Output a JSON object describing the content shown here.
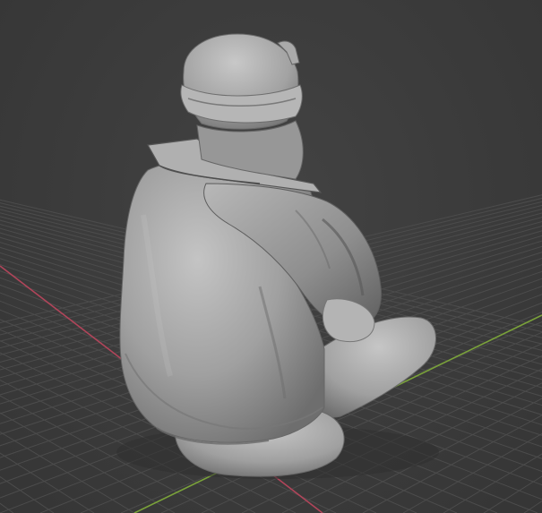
{
  "viewport": {
    "background": "#3d3d3d",
    "grid_color": "#4c4c4c",
    "x_axis_color": "#b0455a",
    "y_axis_color": "#7aa23a"
  },
  "model": {
    "icon": "seated-figure-sculpt-icon",
    "shading": "solid",
    "base_color": "#a3a3a3"
  }
}
